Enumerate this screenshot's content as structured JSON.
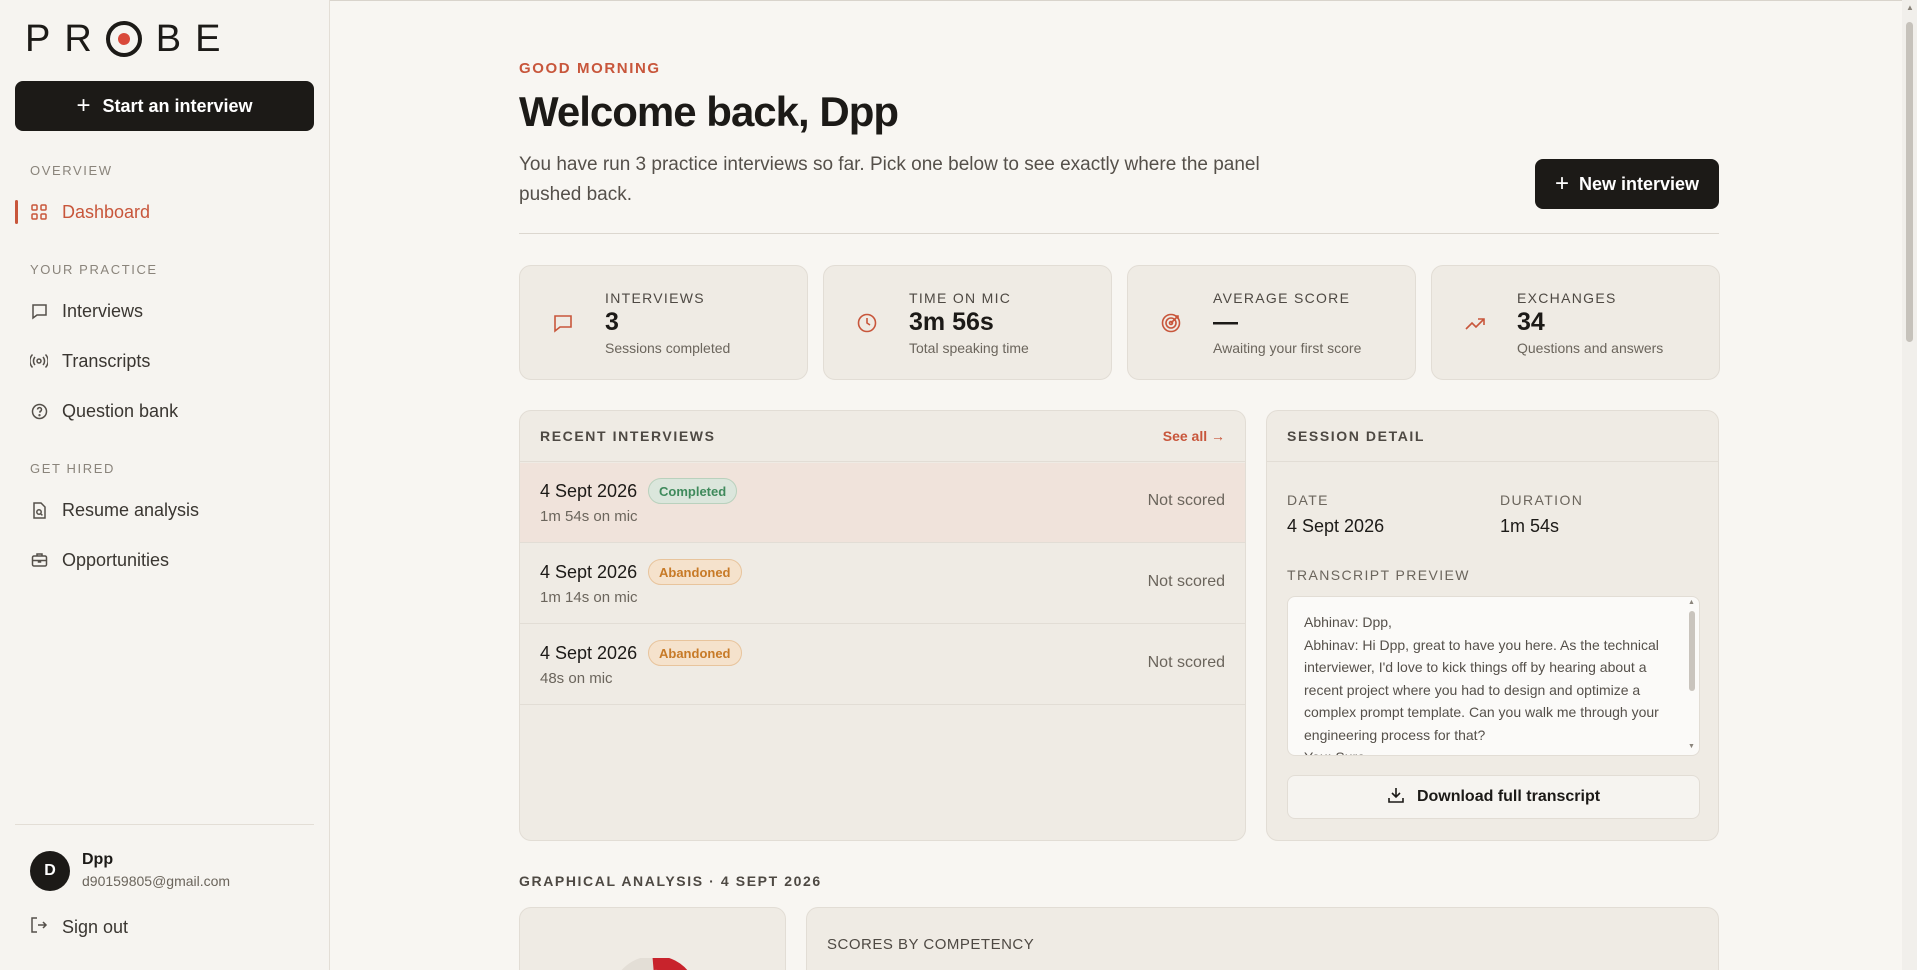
{
  "brand": {
    "name": "PROBE",
    "accent": "#c8563b",
    "dark": "#1c1a17"
  },
  "sidebar": {
    "start_label": "Start an interview",
    "sections": {
      "overview": "OVERVIEW",
      "practice": "YOUR PRACTICE",
      "hired": "GET HIRED"
    },
    "items": {
      "dashboard": "Dashboard",
      "interviews": "Interviews",
      "transcripts": "Transcripts",
      "question_bank": "Question bank",
      "resume": "Resume analysis",
      "opportunities": "Opportunities"
    },
    "user": {
      "initial": "D",
      "name": "Dpp",
      "email": "d90159805@gmail.com"
    },
    "signout_label": "Sign out"
  },
  "header": {
    "greeting": "GOOD MORNING",
    "title": "Welcome back, Dpp",
    "subtitle": "You have run 3 practice interviews so far. Pick one below to see exactly where the panel pushed back.",
    "new_label": "New interview"
  },
  "stats": [
    {
      "label": "INTERVIEWS",
      "value": "3",
      "sub": "Sessions completed",
      "icon": "chat-icon"
    },
    {
      "label": "TIME ON MIC",
      "value": "3m 56s",
      "sub": "Total speaking time",
      "icon": "clock-icon"
    },
    {
      "label": "AVERAGE SCORE",
      "value": "—",
      "sub": "Awaiting your first score",
      "icon": "target-icon"
    },
    {
      "label": "EXCHANGES",
      "value": "34",
      "sub": "Questions and answers",
      "icon": "trend-icon"
    }
  ],
  "recent": {
    "title": "RECENT INTERVIEWS",
    "see_all": "See all →",
    "rows": [
      {
        "date": "4 Sept 2026",
        "status": "Completed",
        "mic": "1m 54s on mic",
        "score": "Not scored"
      },
      {
        "date": "4 Sept 2026",
        "status": "Abandoned",
        "mic": "1m 14s on mic",
        "score": "Not scored"
      },
      {
        "date": "4 Sept 2026",
        "status": "Abandoned",
        "mic": "48s on mic",
        "score": "Not scored"
      }
    ]
  },
  "detail": {
    "title": "SESSION DETAIL",
    "date_label": "DATE",
    "date": "4 Sept 2026",
    "duration_label": "DURATION",
    "duration": "1m 54s",
    "preview_label": "TRANSCRIPT PREVIEW",
    "transcript": "Abhinav: Dpp,\nAbhinav: Hi Dpp, great to have you here. As the technical interviewer, I'd love to kick things off by hearing about a recent project where you had to design and optimize a complex prompt template. Can you walk me through your engineering process for that?\nYou: Sure",
    "download_label": "Download full transcript"
  },
  "analysis": {
    "title": "GRAPHICAL ANALYSIS · 4 SEPT 2026",
    "scores_title": "SCORES BY COMPETENCY"
  }
}
